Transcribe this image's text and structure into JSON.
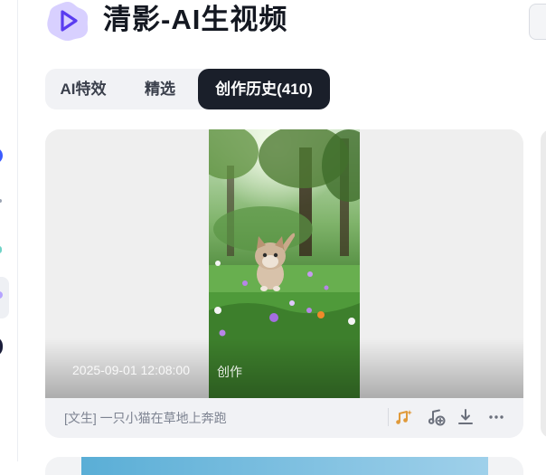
{
  "header": {
    "title": "清影-AI生视频",
    "logo_icon": "play-triangle-icon",
    "accent_color": "#7b5cff"
  },
  "tabs": [
    {
      "label": "AI特效",
      "active": false
    },
    {
      "label": "精选",
      "active": false
    },
    {
      "label": "创作历史(410)",
      "active": true
    }
  ],
  "card": {
    "timestamp": "2025-09-01 12:08:00",
    "badge": "创作",
    "prompt": "[文生] 一只小猫在草地上奔跑",
    "actions": [
      "music-icon",
      "add-audio-icon",
      "download-icon",
      "more-icon"
    ]
  }
}
